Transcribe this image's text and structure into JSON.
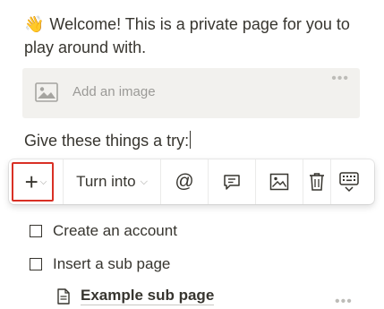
{
  "page": {
    "welcome_emoji": "👋",
    "welcome_text": "Welcome! This is a private page for you to play around with.",
    "image_block": {
      "label": "Add an image",
      "menu_glyph": "•••"
    },
    "try_text": "Give these things a try:",
    "hidden_item": "(---- -- ------ --- ---------)",
    "todos": [
      {
        "label": "Create an account",
        "checked": false
      },
      {
        "label": "Insert a sub page",
        "checked": false
      }
    ],
    "subpage": {
      "label": "Example sub page",
      "menu_glyph": "•••"
    }
  },
  "toolbar": {
    "plus_glyph": "+",
    "plus_chevron": "⌵",
    "turn_into_label": "Turn into",
    "turn_into_chevron": "⌵",
    "mention_glyph": "@",
    "icons": [
      "comment-icon",
      "image-icon",
      "trash-icon",
      "keyboard-icon"
    ],
    "highlight_color": "#d93025"
  }
}
